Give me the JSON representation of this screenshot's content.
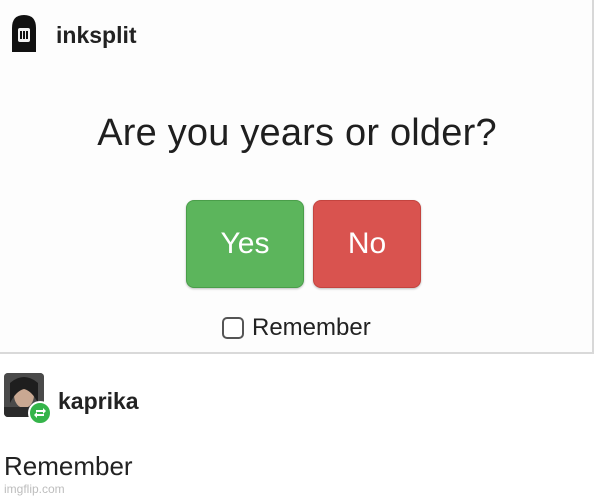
{
  "top_post": {
    "username": "inksplit",
    "question": "Are you years or older?",
    "yes_label": "Yes",
    "no_label": "No",
    "remember_label": "Remember",
    "remember_checked": false
  },
  "reply": {
    "username": "kaprika",
    "text": "Remember"
  },
  "watermark": "imgflip.com",
  "colors": {
    "yes_button": "#5cb55c",
    "no_button": "#d9534f",
    "reblog_badge": "#35b44a"
  },
  "icons": {
    "top_avatar": "hooded-figure-avatar",
    "reply_avatar": "user-photo-avatar",
    "reblog": "reblog-icon"
  }
}
